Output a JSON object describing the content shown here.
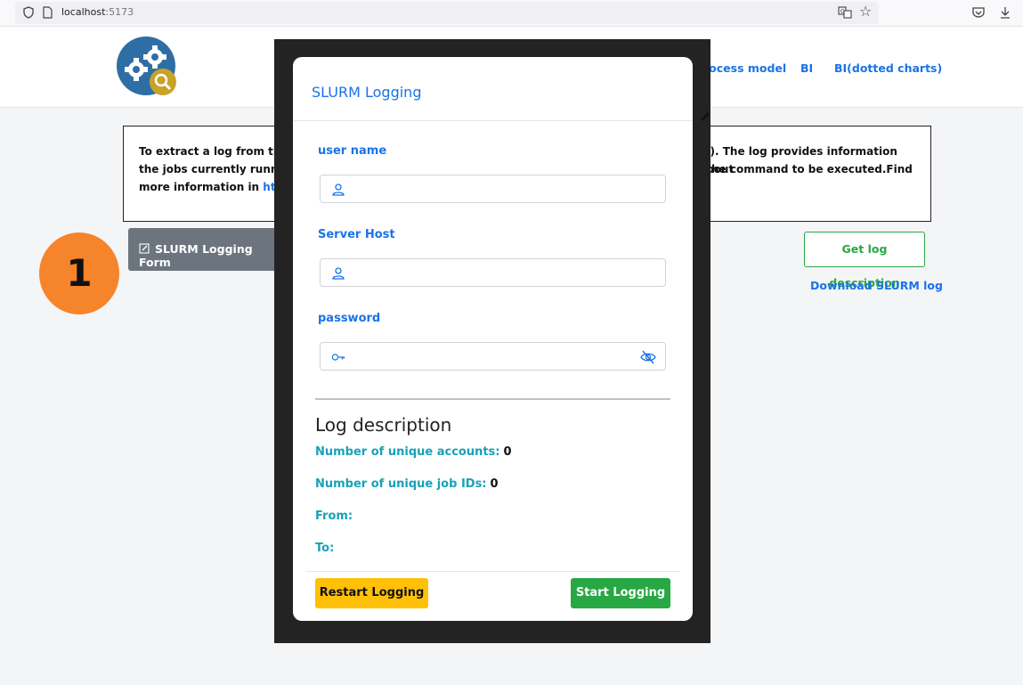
{
  "browser": {
    "url_host": "localhost",
    "url_port": ":5173"
  },
  "nav": {
    "items": [
      {
        "label": "rocess model"
      },
      {
        "label": "BI"
      },
      {
        "label": "BI(dotted charts)"
      }
    ]
  },
  "info": {
    "line1_start": "To extract a log from the",
    "line1_end": "m). The log provides information about",
    "line2_start": "the jobs currently running",
    "line2_end": "he command to be executed.Find",
    "line3_start": "more information in",
    "line3_link": "https:"
  },
  "actions": {
    "form_button_label": "SLURM Logging Form",
    "get_description_label": "Get log description",
    "download_label": "Download SLURM log"
  },
  "step_badge": "1",
  "modal": {
    "title": "SLURM Logging",
    "fields": {
      "username": {
        "label": "user name",
        "value": ""
      },
      "server_host": {
        "label": "Server Host",
        "value": ""
      },
      "password": {
        "label": "password",
        "value": ""
      }
    },
    "log_description": {
      "heading": "Log description",
      "unique_accounts_label": "Number of unique accounts:",
      "unique_accounts_value": "0",
      "unique_job_ids_label": "Number of unique job IDs:",
      "unique_job_ids_value": "0",
      "from_label": "From:",
      "to_label": "To:"
    },
    "restart_label": "Restart Logging",
    "start_label": "Start Logging"
  },
  "colors": {
    "primary": "#1a73e8",
    "success": "#28a745",
    "warning": "#ffc107",
    "info": "#17a2b8",
    "secondary": "#6c757d",
    "badge": "#f6842b"
  }
}
